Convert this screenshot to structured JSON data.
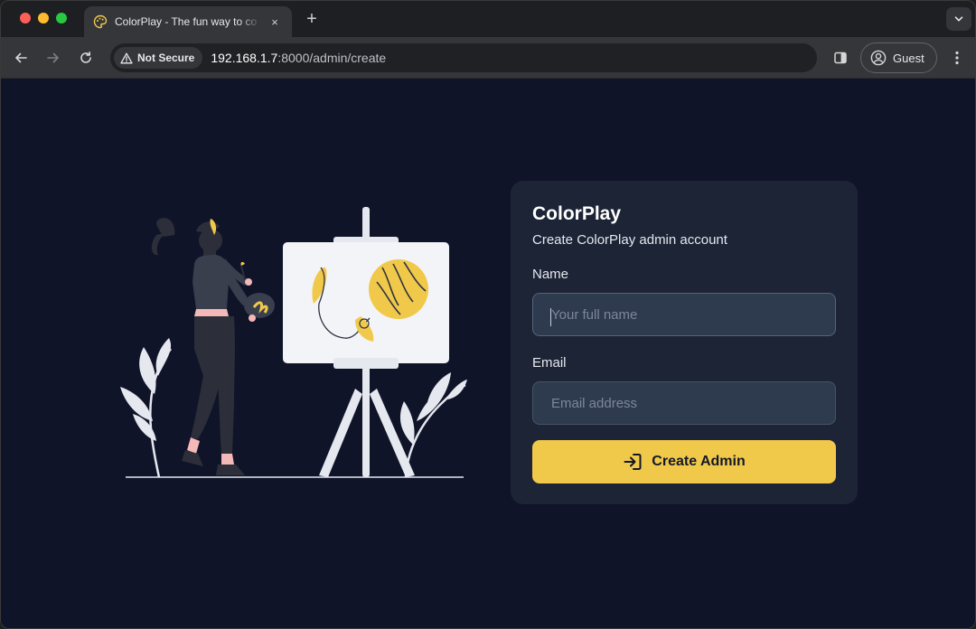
{
  "browser": {
    "tab": {
      "title": "ColorPlay - The fun way to co",
      "close": "×"
    },
    "new_tab": "+",
    "security_label": "Not Secure",
    "url_host": "192.168.1.7",
    "url_path": ":8000/admin/create",
    "profile_label": "Guest"
  },
  "form": {
    "brand": "ColorPlay",
    "subtitle": "Create ColorPlay admin account",
    "name_label": "Name",
    "name_placeholder": "Your full name",
    "email_label": "Email",
    "email_placeholder": "Email address",
    "submit_label": "Create Admin"
  },
  "colors": {
    "page_background": "#0f1429",
    "card_background": "#1c2436",
    "input_background": "#2e3a4e",
    "accent": "#f1c94a"
  },
  "icons": {
    "back": "arrow-left-icon",
    "forward": "arrow-right-icon",
    "reload": "reload-icon",
    "warning": "warning-triangle-icon",
    "side_panel": "side-panel-icon",
    "profile": "user-circle-icon",
    "menu": "kebab-menu-icon",
    "submit": "login-arrow-icon"
  }
}
